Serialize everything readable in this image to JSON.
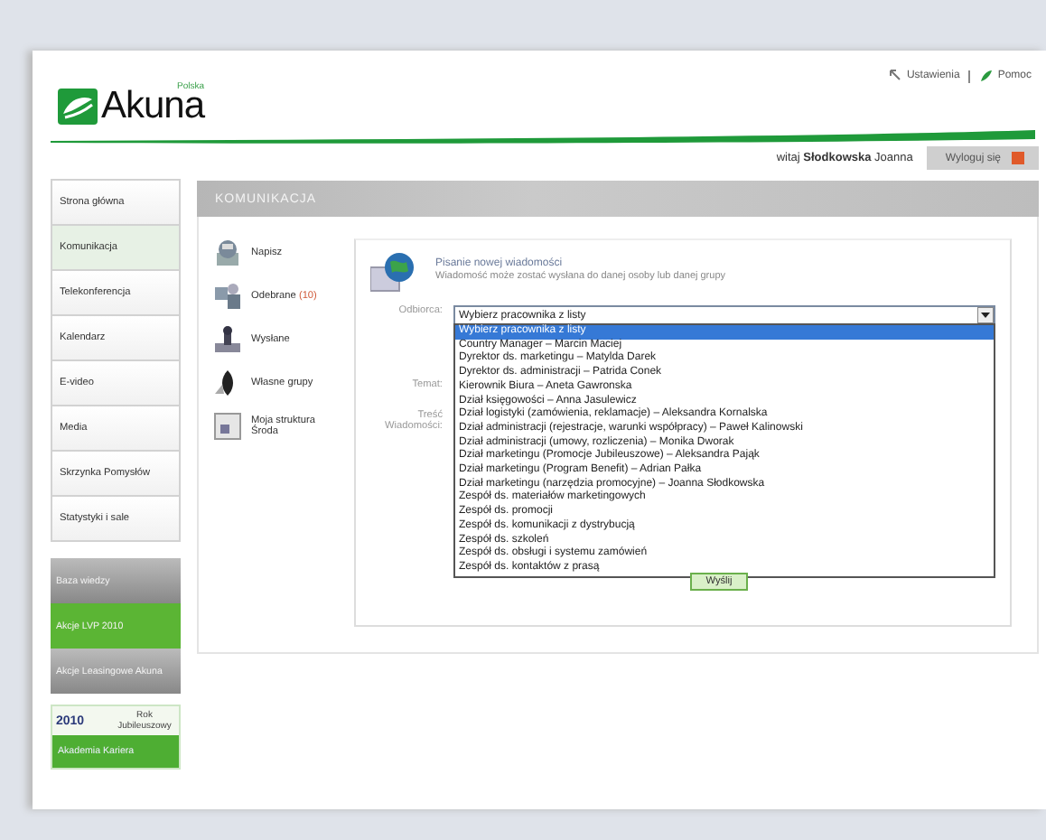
{
  "header": {
    "logo": "Akuna",
    "logo_tag": "Polska",
    "links": [
      {
        "label": "Ustawienia",
        "kind": "settings"
      },
      {
        "label": "Pomoc",
        "kind": "help"
      }
    ]
  },
  "user": {
    "greeting": "witaj",
    "surname": "Słodkowska",
    "first_name": "Joanna",
    "logout": "Wyloguj się"
  },
  "nav": [
    {
      "label": "Strona główna",
      "selected": false
    },
    {
      "label": "Komunikacja",
      "selected": true
    },
    {
      "label": "Telekonferencja",
      "selected": false
    },
    {
      "label": "Kalendarz",
      "selected": false
    },
    {
      "label": "E-video",
      "selected": false
    },
    {
      "label": "Media",
      "selected": false
    },
    {
      "label": "Skrzynka Pomysłów",
      "selected": false
    },
    {
      "label": "Statystyki i sale",
      "selected": false
    }
  ],
  "promos": [
    {
      "kind": "gray",
      "label": "Baza wiedzy"
    },
    {
      "kind": "green",
      "label": "Akcje LVP 2010"
    },
    {
      "kind": "gray",
      "label": "Akcje Leasingowe Akuna"
    }
  ],
  "banner": {
    "year": "2010",
    "label": "Rok Jubileuszowy",
    "footer": "Akademia Kariera"
  },
  "section_title": "KOMUNIKACJA",
  "mail_menu": [
    {
      "kind": "compose",
      "label": "Napisz"
    },
    {
      "kind": "inbox",
      "label": "Odebrane",
      "count": "(10)"
    },
    {
      "kind": "sent",
      "label": "Wysłane"
    },
    {
      "kind": "groups",
      "label": "Własne grupy"
    },
    {
      "kind": "structure",
      "label": "Moja struktura Środa"
    }
  ],
  "form": {
    "title": "Pisanie nowej wiadomości",
    "subtitle": "Wiadomość może zostać wysłana do danej osoby lub danej grupy",
    "recipient_label": "Odbiorca:",
    "recipient_value": "Wybierz pracownika z listy",
    "options": [
      {
        "label": "Wybierz pracownika z listy",
        "selected": true
      },
      {
        "label": "Country Manager – Marcin Maciej",
        "selected": false
      },
      {
        "label": "Dyrektor ds. marketingu – Matylda Darek",
        "selected": false
      },
      {
        "label": "Dyrektor ds. administracji – Patrida Conek",
        "selected": false
      },
      {
        "label": "Kierownik Biura – Aneta Gawronska",
        "selected": false
      },
      {
        "label": "Dział księgowości – Anna Jasulewicz",
        "selected": false
      },
      {
        "label": "Dział logistyki (zamówienia, reklamacje) – Aleksandra Kornalska",
        "selected": false
      },
      {
        "label": "Dział administracji (rejestracje, warunki współpracy) – Paweł Kalinowski",
        "selected": false
      },
      {
        "label": "Dział administracji (umowy, rozliczenia) – Monika Dworak",
        "selected": false
      },
      {
        "label": "Dział marketingu (Promocje Jubileuszowe) – Aleksandra Pająk",
        "selected": false
      },
      {
        "label": "Dział marketingu (Program Benefit) – Adrian Pałka",
        "selected": false
      },
      {
        "label": "Dział marketingu (narzędzia promocyjne) – Joanna Słodkowska",
        "selected": false
      },
      {
        "label": "Zespół ds. materiałów marketingowych",
        "selected": false
      },
      {
        "label": "Zespół ds. promocji",
        "selected": false
      },
      {
        "label": "Zespół ds. komunikacji z dystrybucją",
        "selected": false
      },
      {
        "label": "Zespół ds. szkoleń",
        "selected": false
      },
      {
        "label": "Zespół ds. obsługi i systemu zamówień",
        "selected": false
      },
      {
        "label": "Zespół ds. kontaktów z prasą",
        "selected": false
      }
    ],
    "subject_label": "Temat:",
    "body_label": "Treść Wiadomości:",
    "send": "Wyślij"
  }
}
